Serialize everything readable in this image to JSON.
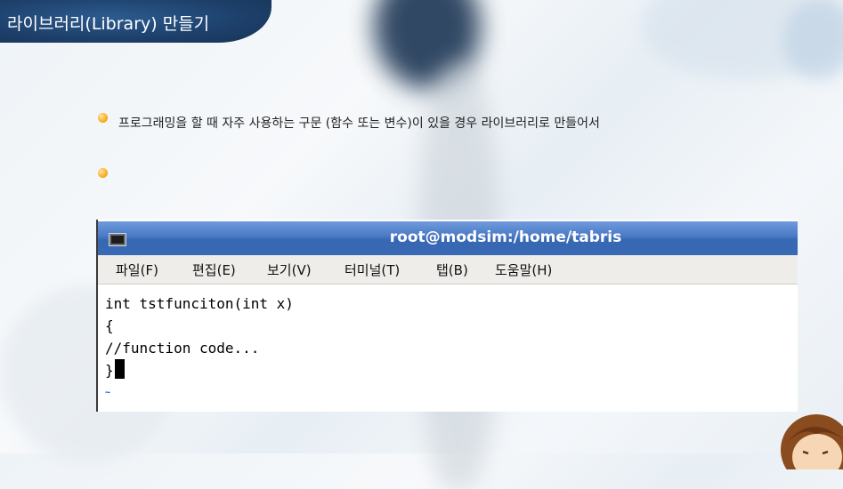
{
  "header": {
    "title": "라이브러리(Library) 만들기"
  },
  "bullets": [
    {
      "text": "프로그래밍을 할 때 자주 사용하는 구문 (함수 또는 변수)이 있을 경우 라이브러리로 만들어서"
    },
    {
      "text": ""
    }
  ],
  "terminal": {
    "title": "root@modsim:/home/tabris",
    "menu": [
      "파일(F)",
      "편집(E)",
      "보기(V)",
      "터미널(T)",
      "탭(B)",
      "도움말(H)"
    ],
    "lines": [
      "int tstfunciton(int x)",
      "{",
      "//function code...",
      "}"
    ],
    "empty_line_marker": "~"
  },
  "colors": {
    "banner": "#1d3f6a",
    "titlebar": "#4a79c4",
    "bullet": "#f7b328"
  }
}
